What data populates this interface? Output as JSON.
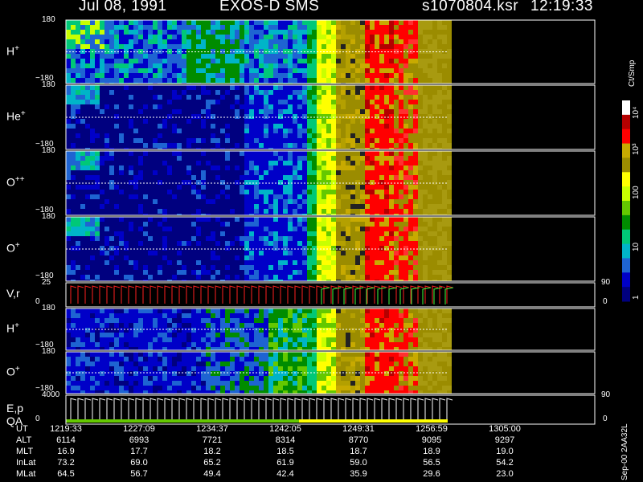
{
  "header": {
    "date": "Jul 08, 1991",
    "mission": "EXOS-D SMS",
    "file": "s1070804.ksr",
    "time": "12:19:33"
  },
  "colors": {
    "background": "#000000",
    "scale": [
      "#00007f",
      "#0000c8",
      "#1e64d2",
      "#00b4c8",
      "#00c878",
      "#008c00",
      "#64c800",
      "#c8ff00",
      "#ffff00",
      "#9b8c00",
      "#c8aa00",
      "#ff0000",
      "#b40000",
      "#ffffff"
    ]
  },
  "panels": [
    {
      "id": "h-plus-1",
      "label_main": "H",
      "label_sup": "+",
      "tick_top": "180",
      "tick_bottom": "−180"
    },
    {
      "id": "he-plus",
      "label_main": "He",
      "label_sup": "+",
      "tick_top": "180",
      "tick_bottom": "−180"
    },
    {
      "id": "o-plus-plus",
      "label_main": "O",
      "label_sup": "++",
      "tick_top": "180",
      "tick_bottom": "−180"
    },
    {
      "id": "o-plus-1",
      "label_main": "O",
      "label_sup": "+",
      "tick_top": "180",
      "tick_bottom": "−180"
    },
    {
      "id": "vr",
      "label_main": "V,r",
      "label_sup": "",
      "tick_top": "25",
      "tick_bottom": "0",
      "right_top": "90",
      "right_bottom": "0"
    },
    {
      "id": "h-plus-2",
      "label_main": "H",
      "label_sup": "+",
      "tick_top": "180",
      "tick_bottom": "−180"
    },
    {
      "id": "o-plus-2",
      "label_main": "O",
      "label_sup": "+",
      "tick_top": "180",
      "tick_bottom": "−180"
    },
    {
      "id": "ep",
      "label_main": "E,p",
      "label_sup": "",
      "label_second": "QA",
      "tick_top": "4000",
      "tick_bottom": "0",
      "right_top": "90",
      "right_bottom": "0"
    }
  ],
  "colorbar": {
    "unit": "Ct/Smp",
    "ticks": [
      "10⁴",
      "10³",
      "100",
      "10",
      "1"
    ]
  },
  "footer_text": "Sep-00 2AA32L",
  "ephemeris": {
    "labels": [
      "UT",
      "ALT",
      "MLT",
      "InLat",
      "MLat"
    ],
    "rows": [
      [
        "1219:33",
        "1227:09",
        "1234:37",
        "1242:05",
        "1249:31",
        "1256:59",
        "1305:00"
      ],
      [
        "6114",
        "6993",
        "7721",
        "8314",
        "8770",
        "9095",
        "9297"
      ],
      [
        "16.9",
        "17.7",
        "18.2",
        "18.5",
        "18.7",
        "18.9",
        "19.0"
      ],
      [
        "73.2",
        "69.0",
        "65.2",
        "61.9",
        "59.0",
        "56.5",
        "54.2"
      ],
      [
        "64.5",
        "56.7",
        "49.4",
        "42.4",
        "35.9",
        "29.6",
        "23.0"
      ]
    ]
  },
  "chart_data": {
    "type": "heatmap",
    "title": "Jul 08, 1991   EXOS-D SMS",
    "x_axis": "UT",
    "x_ticks": [
      "1219:33",
      "1227:09",
      "1234:37",
      "1242:05",
      "1249:31",
      "1256:59",
      "1305:00"
    ],
    "panels": [
      "H+",
      "He+",
      "O++",
      "O+",
      "V,r",
      "H+",
      "O+",
      "E,p QA"
    ],
    "y_range_pitch_panels": [
      -180,
      180
    ],
    "y_range_vr": [
      0,
      25
    ],
    "y_range_ep": [
      0,
      4000
    ],
    "colorbar": {
      "unit": "Ct/Smp",
      "scale": "log",
      "range": [
        1,
        10000
      ]
    }
  }
}
